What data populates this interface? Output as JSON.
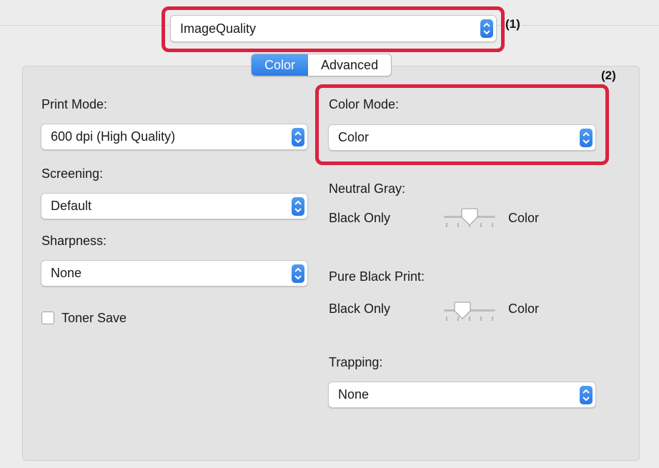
{
  "preset_menu": {
    "value": "ImageQuality"
  },
  "callouts": {
    "one": "(1)",
    "two": "(2)"
  },
  "tabs": [
    {
      "label": "Color",
      "active": true
    },
    {
      "label": "Advanced",
      "active": false
    }
  ],
  "left_column": {
    "print_mode": {
      "label": "Print Mode:",
      "value": "600 dpi (High Quality)"
    },
    "screening": {
      "label": "Screening:",
      "value": "Default"
    },
    "sharpness": {
      "label": "Sharpness:",
      "value": "None"
    },
    "toner_save": {
      "label": "Toner Save",
      "checked": false
    }
  },
  "right_column": {
    "color_mode": {
      "label": "Color Mode:",
      "value": "Color"
    },
    "neutral_gray": {
      "label": "Neutral Gray:",
      "min_label": "Black Only",
      "max_label": "Color",
      "level": 0.5
    },
    "pure_black_print": {
      "label": "Pure Black Print:",
      "min_label": "Black Only",
      "max_label": "Color",
      "level": 0.33
    },
    "trapping": {
      "label": "Trapping:",
      "value": "None"
    }
  },
  "colors": {
    "highlight": "#d9223f",
    "accent": "#2c7be5"
  },
  "icons": {
    "stepper": "chevron-up-down-icon"
  }
}
